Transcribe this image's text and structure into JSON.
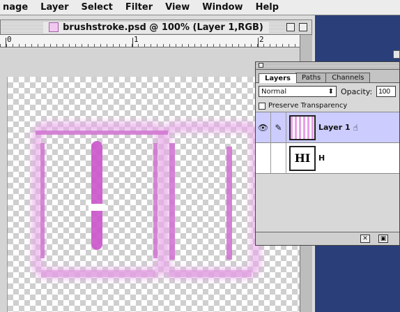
{
  "menubar": {
    "items": [
      "nage",
      "Layer",
      "Select",
      "Filter",
      "View",
      "Window",
      "Help"
    ]
  },
  "document": {
    "title": "brushstroke.psd @ 100% (Layer 1,RGB)",
    "ruler_labels": [
      "0",
      "1",
      "2"
    ]
  },
  "artwork": {
    "stroke_color": "#cc55cc",
    "glow_color": "#e8a8e8"
  },
  "layers_palette": {
    "tabs": [
      "Layers",
      "Paths",
      "Channels"
    ],
    "active_tab": "Layers",
    "blend_mode": "Normal",
    "opacity_label": "Opacity:",
    "opacity_value": "100",
    "preserve_transparency_label": "Preserve Transparency",
    "layers": [
      {
        "name": "Layer 1",
        "selected": true,
        "visible": true,
        "thumb": "brush-pattern"
      },
      {
        "name": "H",
        "selected": false,
        "visible": false,
        "thumb_text": "HI"
      }
    ],
    "footer_buttons": [
      "new-layer",
      "delete-layer"
    ]
  },
  "icons": [
    "document-icon",
    "zoom-box-icon",
    "eye-icon",
    "brush-icon",
    "cursor-hand-icon",
    "dropdown-arrows-icon"
  ]
}
